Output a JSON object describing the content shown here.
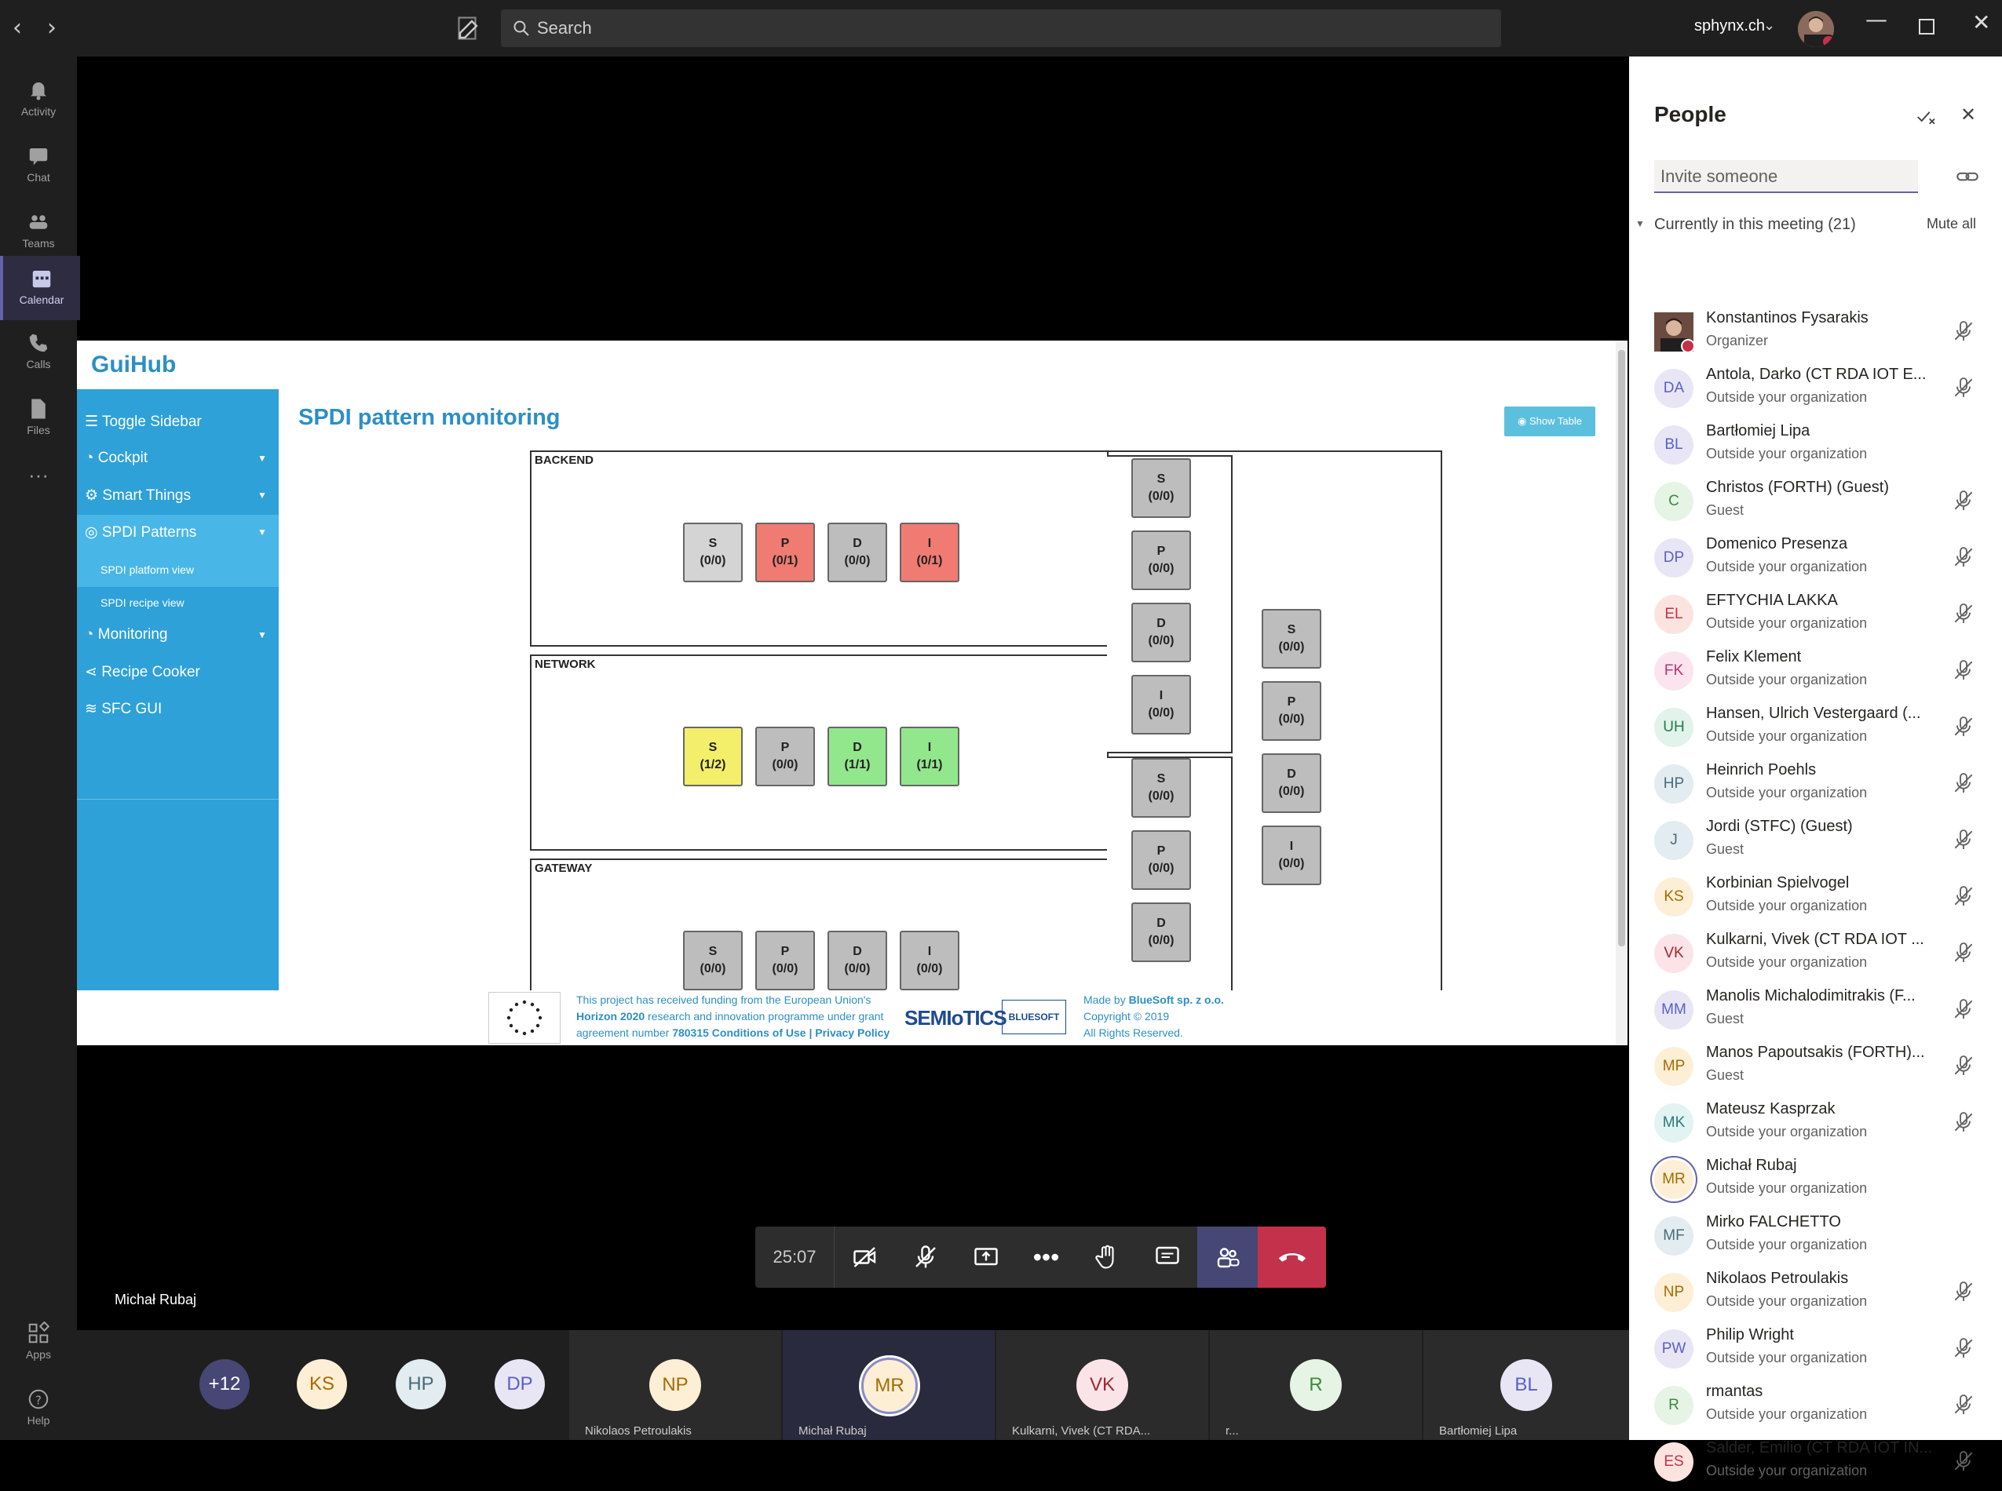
{
  "titlebar": {
    "search_placeholder": "Search",
    "tenant": "sphynx.ch",
    "back_icon": "chevron-left-icon",
    "forward_icon": "chevron-right-icon"
  },
  "rail": {
    "items": [
      {
        "label": "Activity",
        "icon": "bell-icon"
      },
      {
        "label": "Chat",
        "icon": "chat-icon"
      },
      {
        "label": "Teams",
        "icon": "teams-icon"
      },
      {
        "label": "Calendar",
        "icon": "calendar-icon",
        "active": true
      },
      {
        "label": "Calls",
        "icon": "phone-icon"
      },
      {
        "label": "Files",
        "icon": "file-icon"
      },
      {
        "label": "Apps",
        "icon": "apps-icon"
      },
      {
        "label": "Help",
        "icon": "help-icon"
      }
    ]
  },
  "guihub": {
    "logo": "GuiHub",
    "sidebar": {
      "toggle": "Toggle Sidebar",
      "cockpit": "Cockpit",
      "smart_things": "Smart Things",
      "spdi_patterns": "SPDI Patterns",
      "sub1": "SPDI platform view",
      "sub2": "SPDI recipe view",
      "monitoring": "Monitoring",
      "recipe_cooker": "Recipe Cooker",
      "sfc_gui": "SFC GUI"
    },
    "title": "SPDI pattern monitoring",
    "show_table": "Show Table",
    "zones": {
      "backend": "BACKEND",
      "network": "NETWORK",
      "gateway": "GATEWAY"
    },
    "backend_tiles": [
      {
        "l": "S",
        "v": "(0/0)",
        "c": "#d4d4d4"
      },
      {
        "l": "P",
        "v": "(0/1)",
        "c": "#f07b72"
      },
      {
        "l": "D",
        "v": "(0/0)",
        "c": "#bdbdbd"
      },
      {
        "l": "I",
        "v": "(0/1)",
        "c": "#f07b72"
      }
    ],
    "network_tiles": [
      {
        "l": "S",
        "v": "(1/2)",
        "c": "#f3ef6a"
      },
      {
        "l": "P",
        "v": "(0/0)",
        "c": "#bdbdbd"
      },
      {
        "l": "D",
        "v": "(1/1)",
        "c": "#92e78c"
      },
      {
        "l": "I",
        "v": "(1/1)",
        "c": "#92e78c"
      }
    ],
    "gateway_tiles": [
      {
        "l": "S",
        "v": "(0/0)"
      },
      {
        "l": "P",
        "v": "(0/0)"
      },
      {
        "l": "D",
        "v": "(0/0)"
      },
      {
        "l": "I",
        "v": "(0/0)"
      }
    ],
    "right_col1": [
      {
        "l": "S",
        "v": "(0/0)"
      },
      {
        "l": "P",
        "v": "(0/0)"
      },
      {
        "l": "D",
        "v": "(0/0)"
      },
      {
        "l": "I",
        "v": "(0/0)"
      },
      {
        "l": "S",
        "v": "(0/0)"
      },
      {
        "l": "P",
        "v": "(0/0)"
      },
      {
        "l": "D",
        "v": "(0/0)"
      }
    ],
    "right_col2": [
      {
        "l": "S",
        "v": "(0/0)"
      },
      {
        "l": "P",
        "v": "(0/0)"
      },
      {
        "l": "D",
        "v": "(0/0)"
      },
      {
        "l": "I",
        "v": "(0/0)"
      }
    ],
    "footer": {
      "funding1": "This project has received funding from the European Union's",
      "funding2a": "Horizon 2020",
      "funding2b": " research and innovation programme under grant",
      "funding3a": "agreement number ",
      "funding3b": "780315",
      "funding3c": " Conditions of Use",
      "funding3d": " | Privacy Policy",
      "semiotics": "SEMIoTICS",
      "bluesoft": "BLUESOFT",
      "made_by_a": "Made by ",
      "made_by_b": "BlueSoft sp. z o.o.",
      "copyright": "Copyright © 2019",
      "rights": "All Rights Reserved."
    }
  },
  "meeting": {
    "presenter": "Michał Rubaj",
    "timer": "25:07",
    "gallery": {
      "overflow": "+12",
      "small": [
        "KS",
        "HP",
        "DP"
      ],
      "tiles": [
        {
          "initials": "NP",
          "name": "Nikolaos Petroulakis"
        },
        {
          "initials": "MR",
          "name": "Michał Rubaj"
        },
        {
          "initials": "VK",
          "name": "Kulkarni, Vivek (CT RDA..."
        },
        {
          "initials": "R",
          "name": "r..."
        },
        {
          "initials": "BL",
          "name": "Bartłomiej Lipa"
        }
      ]
    }
  },
  "people": {
    "title": "People",
    "invite_placeholder": "Invite someone",
    "current_label": "Currently in this meeting (21)",
    "mute_all": "Mute all",
    "participants": [
      {
        "initials": "",
        "name": "Konstantinos Fysarakis",
        "role": "Organizer",
        "bg": "#6b4b3f",
        "fg": "#fff",
        "muted": true,
        "photo": true
      },
      {
        "initials": "DA",
        "name": "Antola, Darko (CT RDA IOT E...",
        "role": "Outside your organization",
        "bg": "#e8e6f5",
        "fg": "#5b5fc7",
        "muted": true
      },
      {
        "initials": "BL",
        "name": "Bartłomiej Lipa",
        "role": "Outside your organization",
        "bg": "#e8e6f5",
        "fg": "#5b5fc7",
        "muted": false
      },
      {
        "initials": "C",
        "name": "Christos (FORTH) (Guest)",
        "role": "Guest",
        "bg": "#e5f4e5",
        "fg": "#3a8a3a",
        "muted": true
      },
      {
        "initials": "DP",
        "name": "Domenico Presenza",
        "role": "Outside your organization",
        "bg": "#e8e6f5",
        "fg": "#5b5fc7",
        "muted": true
      },
      {
        "initials": "EL",
        "name": "EFTYCHIA LAKKA",
        "role": "Outside your organization",
        "bg": "#fbe4df",
        "fg": "#c4314b",
        "muted": true
      },
      {
        "initials": "FK",
        "name": "Felix Klement",
        "role": "Outside your organization",
        "bg": "#fce4ef",
        "fg": "#b8336a",
        "muted": true
      },
      {
        "initials": "UH",
        "name": "Hansen, Ulrich Vestergaard (...",
        "role": "Outside your organization",
        "bg": "#e1f3ea",
        "fg": "#237b4b",
        "muted": true
      },
      {
        "initials": "HP",
        "name": "Heinrich Poehls",
        "role": "Outside your organization",
        "bg": "#e3ecf0",
        "fg": "#4a6b7a",
        "muted": true
      },
      {
        "initials": "J",
        "name": "Jordi (STFC) (Guest)",
        "role": "Guest",
        "bg": "#e3ecf0",
        "fg": "#4a6b7a",
        "muted": true
      },
      {
        "initials": "KS",
        "name": "Korbinian Spielvogel",
        "role": "Outside your organization",
        "bg": "#fcefd6",
        "fg": "#a86a00",
        "muted": true
      },
      {
        "initials": "VK",
        "name": "Kulkarni, Vivek (CT RDA IOT ...",
        "role": "Outside your organization",
        "bg": "#fbe4e8",
        "fg": "#a4262c",
        "muted": true
      },
      {
        "initials": "MM",
        "name": "Manolis Michalodimitrakis (F...",
        "role": "Guest",
        "bg": "#e8e6f5",
        "fg": "#5b5fc7",
        "muted": true
      },
      {
        "initials": "MP",
        "name": "Manos Papoutsakis (FORTH)...",
        "role": "Guest",
        "bg": "#fcefd6",
        "fg": "#a86a00",
        "muted": true
      },
      {
        "initials": "MK",
        "name": "Mateusz Kasprzak",
        "role": "Outside your organization",
        "bg": "#e1f3f3",
        "fg": "#2a7a7a",
        "muted": true
      },
      {
        "initials": "MR",
        "name": "Michał Rubaj",
        "role": "Outside your organization",
        "bg": "#fcefd6",
        "fg": "#a86a00",
        "muted": false,
        "speaking": true
      },
      {
        "initials": "MF",
        "name": "Mirko FALCHETTO",
        "role": "Outside your organization",
        "bg": "#e3ecf0",
        "fg": "#4a6b7a",
        "muted": false
      },
      {
        "initials": "NP",
        "name": "Nikolaos Petroulakis",
        "role": "Outside your organization",
        "bg": "#fcefd6",
        "fg": "#a86a00",
        "muted": true
      },
      {
        "initials": "PW",
        "name": "Philip Wright",
        "role": "Outside your organization",
        "bg": "#e8e6f5",
        "fg": "#5b5fc7",
        "muted": true
      },
      {
        "initials": "R",
        "name": "rmantas",
        "role": "Outside your organization",
        "bg": "#e5f4e5",
        "fg": "#3a8a3a",
        "muted": true
      },
      {
        "initials": "ES",
        "name": "Salder, Emilio (CT RDA IOT IN...",
        "role": "Outside your organization",
        "bg": "#fbe4df",
        "fg": "#c4314b",
        "muted": true
      }
    ]
  }
}
